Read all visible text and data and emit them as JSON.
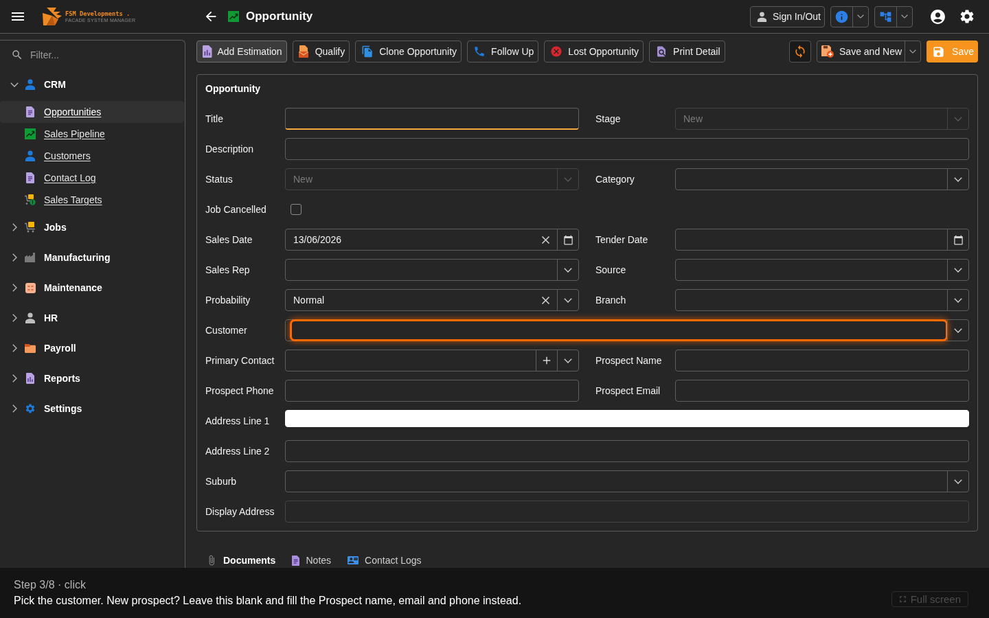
{
  "top_bar": {
    "brand": "FSM Developments .",
    "tagline": "FACADE SYSTEM MANAGER",
    "title": "Opportunity",
    "sign_in": "Sign In/Out"
  },
  "sidebar": {
    "filter": {
      "placeholder": "Filter..."
    },
    "items": [
      {
        "label": "CRM",
        "expanded": true,
        "children": [
          {
            "label": "Opportunities",
            "selected": true
          },
          {
            "label": "Sales Pipeline",
            "selected": false
          },
          {
            "label": "Customers",
            "selected": false
          },
          {
            "label": "Contact Log",
            "selected": false
          },
          {
            "label": "Sales Targets",
            "selected": false
          }
        ]
      },
      {
        "label": "Jobs",
        "expanded": false
      },
      {
        "label": "Manufacturing",
        "expanded": false
      },
      {
        "label": "Maintenance",
        "expanded": false
      },
      {
        "label": "HR",
        "expanded": false
      },
      {
        "label": "Payroll",
        "expanded": false
      },
      {
        "label": "Reports",
        "expanded": false
      },
      {
        "label": "Settings",
        "expanded": false
      }
    ]
  },
  "toolbar": {
    "actions": [
      {
        "label": "Add Estimation",
        "hovered": true
      },
      {
        "label": "Qualify",
        "hovered": false
      },
      {
        "label": "Clone Opportunity",
        "hovered": false
      },
      {
        "label": "Follow Up",
        "hovered": false
      },
      {
        "label": "Lost Opportunity",
        "hovered": false
      },
      {
        "label": "Print Detail",
        "hovered": false
      }
    ],
    "save_and_new": "Save and New",
    "save": "Save"
  },
  "form": {
    "title": "Opportunity",
    "rows": [
      {
        "fields": [
          {
            "label": "Title",
            "kind": "text",
            "disabled": false,
            "focused": true,
            "highlighted": false,
            "autofilled": false
          },
          {
            "label": "Stage",
            "kind": "select",
            "value": "New",
            "disabled": true,
            "focused": false,
            "highlighted": false,
            "autofilled": false
          }
        ]
      },
      {
        "fields": [
          {
            "label": "Description",
            "kind": "text",
            "disabled": false,
            "focused": false,
            "highlighted": false,
            "autofilled": false
          }
        ]
      },
      {
        "fields": [
          {
            "label": "Status",
            "kind": "select",
            "value": "New",
            "disabled": true,
            "focused": false,
            "highlighted": false,
            "autofilled": false
          },
          {
            "label": "Category",
            "kind": "select",
            "disabled": false,
            "focused": false,
            "highlighted": false,
            "autofilled": false
          }
        ]
      },
      {
        "fields": [
          {
            "label": "Job Cancelled",
            "kind": "checkbox",
            "checked": false
          }
        ]
      },
      {
        "fields": [
          {
            "label": "Sales Date",
            "kind": "date",
            "value": "13/06/2026",
            "disabled": false,
            "focused": false,
            "highlighted": false,
            "autofilled": false
          },
          {
            "label": "Tender Date",
            "kind": "date",
            "disabled": false,
            "focused": false,
            "highlighted": false,
            "autofilled": false
          }
        ]
      },
      {
        "fields": [
          {
            "label": "Sales Rep",
            "kind": "select",
            "disabled": false,
            "focused": false,
            "highlighted": false,
            "autofilled": false
          },
          {
            "label": "Source",
            "kind": "select",
            "disabled": false,
            "focused": false,
            "highlighted": false,
            "autofilled": false
          }
        ]
      },
      {
        "fields": [
          {
            "label": "Probability",
            "kind": "select",
            "value": "Normal",
            "disabled": false,
            "focused": false,
            "highlighted": false,
            "autofilled": false
          },
          {
            "label": "Branch",
            "kind": "select",
            "disabled": false,
            "focused": false,
            "highlighted": false,
            "autofilled": false
          }
        ]
      },
      {
        "fields": [
          {
            "label": "Customer",
            "kind": "select",
            "disabled": false,
            "focused": false,
            "highlighted": true,
            "autofilled": false
          }
        ]
      },
      {
        "fields": [
          {
            "label": "Primary Contact",
            "kind": "lookup",
            "disabled": false,
            "focused": false,
            "highlighted": false,
            "autofilled": false
          },
          {
            "label": "Prospect Name",
            "kind": "text",
            "disabled": false,
            "focused": false,
            "highlighted": false,
            "autofilled": false
          }
        ]
      },
      {
        "fields": [
          {
            "label": "Prospect Phone",
            "kind": "text",
            "disabled": false,
            "focused": false,
            "highlighted": false,
            "autofilled": false
          },
          {
            "label": "Prospect Email",
            "kind": "text",
            "disabled": false,
            "focused": false,
            "highlighted": false,
            "autofilled": false
          }
        ]
      },
      {
        "fields": [
          {
            "label": "Address Line 1",
            "kind": "text",
            "disabled": false,
            "focused": false,
            "highlighted": false,
            "autofilled": true
          }
        ]
      },
      {
        "fields": [
          {
            "label": "Address Line 2",
            "kind": "text",
            "disabled": false,
            "focused": false,
            "highlighted": false,
            "autofilled": false
          }
        ]
      },
      {
        "fields": [
          {
            "label": "Suburb",
            "kind": "select",
            "disabled": false,
            "focused": false,
            "highlighted": false,
            "autofilled": false
          }
        ]
      },
      {
        "fields": [
          {
            "label": "Display Address",
            "kind": "text",
            "disabled": true,
            "focused": false,
            "highlighted": false,
            "autofilled": false
          }
        ]
      }
    ]
  },
  "detail_tabs": [
    {
      "label": "Documents",
      "selected": true
    },
    {
      "label": "Notes",
      "selected": false
    },
    {
      "label": "Contact Logs",
      "selected": false
    }
  ],
  "tutorial": {
    "step": "Step 3/8 · click",
    "instruction": "Pick the customer. New prospect? Leave this blank and fill the Prospect name, email and phone instead.",
    "fullscreen": "Full screen"
  }
}
